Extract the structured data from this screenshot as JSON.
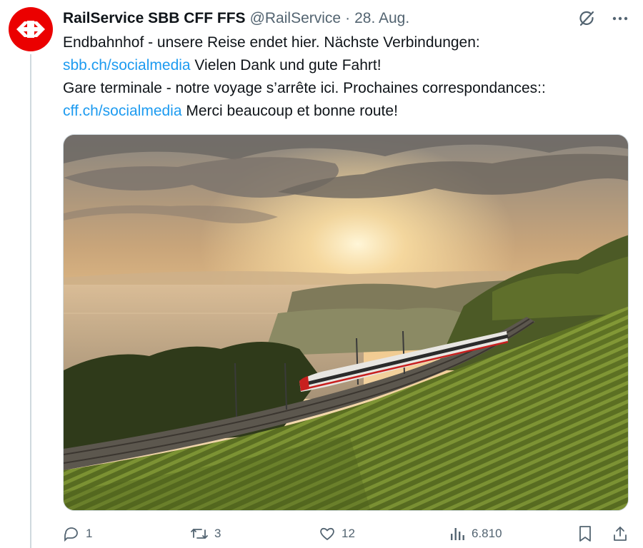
{
  "tweet": {
    "author_name": "RailService SBB CFF FFS",
    "author_handle": "@RailService",
    "separator": "·",
    "timestamp": "28. Aug.",
    "text": {
      "line1": "Endbahnhof - unsere Reise endet hier. Nächste Verbindungen:",
      "line2_link": "sbb.ch/socialmedia",
      "line2_text": " Vielen Dank und gute Fahrt!",
      "line3": "Gare terminale - notre voyage s’arrête ici. Prochaines correspondances::",
      "line4_link": "cff.ch/socialmedia",
      "line4_text": " Merci beaucoup et bonne route!"
    }
  },
  "stats": {
    "replies": "1",
    "reposts": "3",
    "likes": "12",
    "views": "6.810"
  },
  "icons": {
    "avatar": "sbb-logo-icon",
    "grok": "grok-icon",
    "more": "more-icon",
    "reply": "reply-icon",
    "repost": "repost-icon",
    "like": "heart-icon",
    "views": "views-icon",
    "bookmark": "bookmark-icon",
    "share": "share-icon"
  },
  "colors": {
    "brand_red": "#eb0000",
    "link_blue": "#1d9bf0",
    "muted_gray": "#536471",
    "text_dark": "#0f1419"
  }
}
